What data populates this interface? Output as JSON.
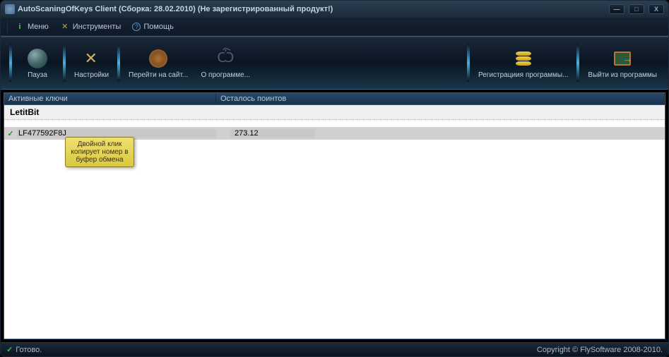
{
  "title": "AutoScaningOfKeys Client (Сборка: 28.02.2010) (Не зарегистрированный продукт!)",
  "menu": {
    "menu_label": "Меню",
    "tools_label": "Инструменты",
    "help_label": "Помощь"
  },
  "toolbar": {
    "pause": "Пауза",
    "settings": "Настройки",
    "goto_site": "Перейти на сайт...",
    "about": "О программе...",
    "register": "Регистрациия программы...",
    "exit": "Выйти из программы"
  },
  "table": {
    "col_keys": "Активные ключи",
    "col_points": "Осталось поинтов",
    "group": "LetitBit",
    "rows": [
      {
        "key": "LF477592F8J",
        "points": "273.12"
      }
    ]
  },
  "tooltip": "Двойной клик копирует номер в буфер обмена",
  "status": {
    "ready": "Готово.",
    "copyright": "Copyright © FlySoftware 2008-2010."
  }
}
